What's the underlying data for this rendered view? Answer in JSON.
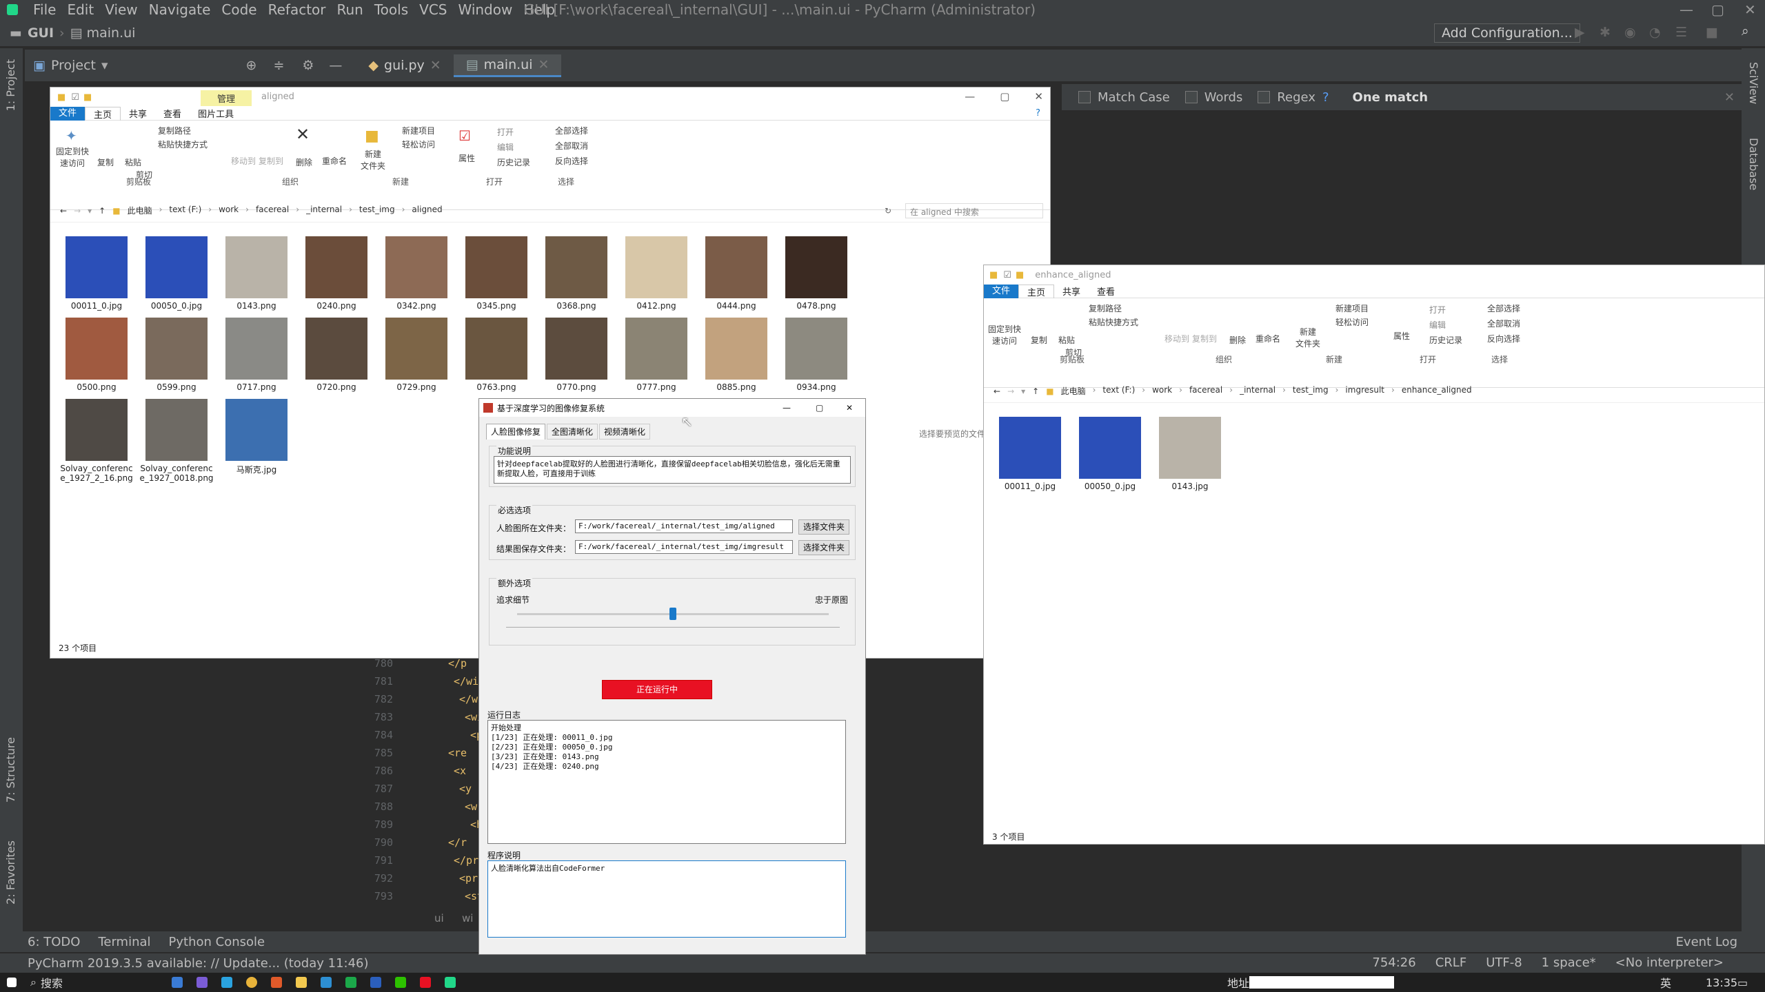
{
  "app": {
    "menu": [
      "File",
      "Edit",
      "View",
      "Navigate",
      "Code",
      "Refactor",
      "Run",
      "Tools",
      "VCS",
      "Window",
      "Help"
    ],
    "window_title": "GUI [F:\\work\\facereal\\_internal\\GUI] - ...\\main.ui - PyCharm (Administrator)",
    "breadcrumb_project": "GUI",
    "breadcrumb_file": "main.ui",
    "add_config": "Add Configuration...",
    "project_label": "Project",
    "tabs": [
      "gui.py",
      "main.ui"
    ],
    "find": {
      "match_case": "Match Case",
      "words": "Words",
      "regex": "Regex",
      "help": "?",
      "result": "One match"
    },
    "left_strip": [
      "1: Project",
      "7: Structure",
      "2: Favorites"
    ],
    "right_strip": [
      "SciView",
      "Database"
    ],
    "editor_lines": [
      {
        "n": "780",
        "t": "</p"
      },
      {
        "n": "781",
        "t": "</wi"
      },
      {
        "n": "782",
        "t": "</wid"
      },
      {
        "n": "783",
        "t": "<widg"
      },
      {
        "n": "784",
        "t": "<pro"
      },
      {
        "n": "785",
        "t": "<re"
      },
      {
        "n": "786",
        "t": "<x"
      },
      {
        "n": "787",
        "t": "<y"
      },
      {
        "n": "788",
        "t": "<w"
      },
      {
        "n": "789",
        "t": "<h"
      },
      {
        "n": "790",
        "t": "</r"
      },
      {
        "n": "791",
        "t": "</pro"
      },
      {
        "n": "792",
        "t": "<pro"
      },
      {
        "n": "793",
        "t": "<st"
      }
    ],
    "editor_breadcrumb": [
      "ui",
      "wi"
    ],
    "bottom_tabs": [
      "6: TODO",
      "Terminal",
      "Python Console"
    ],
    "event_log": "Event Log",
    "status_left": "PyCharm 2019.3.5 available: // Update... (today 11:46)",
    "status_right": [
      "754:26",
      "CRLF",
      "UTF-8",
      "1 space*",
      "<No interpreter>"
    ]
  },
  "explorer1": {
    "title": "aligned",
    "manage_tab": "管理",
    "tabs": [
      "文件",
      "主页",
      "共享",
      "查看",
      "图片工具"
    ],
    "ribbon": {
      "pin": "固定到快\n速访问",
      "copy": "复制",
      "paste": "粘贴",
      "copy_path": "复制路径",
      "paste_shortcut": "粘贴快捷方式",
      "cut": "剪切",
      "move_to": "移动到",
      "copy_to": "复制到",
      "delete": "删除",
      "rename": "重命名",
      "new_folder": "新建\n文件夹",
      "new_item": "新建项目",
      "easy_access": "轻松访问",
      "properties": "属性",
      "open": "打开",
      "edit": "编辑",
      "history": "历史记录",
      "select_all": "全部选择",
      "select_none": "全部取消",
      "invert": "反向选择",
      "groups": [
        "剪贴板",
        "组织",
        "新建",
        "打开",
        "选择"
      ]
    },
    "path": [
      "此电脑",
      "text (F:)",
      "work",
      "facereal",
      "_internal",
      "test_img",
      "aligned"
    ],
    "search_placeholder": "在 aligned 中搜索",
    "files": [
      "00011_0.jpg",
      "00050_0.jpg",
      "0143.png",
      "0240.png",
      "0342.png",
      "0345.png",
      "0368.png",
      "0412.png",
      "0444.png",
      "0478.png",
      "0500.png",
      "0599.png",
      "0717.png",
      "0720.png",
      "0729.png",
      "0763.png",
      "0770.png",
      "0777.png",
      "0885.png",
      "0934.png",
      "Solvay_conference_1927_2_16.png",
      "Solvay_conference_1927_0018.png",
      "马斯克.jpg"
    ],
    "count": "23 个项目",
    "preview_hint": "选择要预览的文件"
  },
  "explorer2": {
    "title": "enhance_aligned",
    "tabs": [
      "文件",
      "主页",
      "共享",
      "查看"
    ],
    "path": [
      "此电脑",
      "text (F:)",
      "work",
      "facereal",
      "_internal",
      "test_img",
      "imgresult",
      "enhance_aligned"
    ],
    "files": [
      "00011_0.jpg",
      "00050_0.jpg",
      "0143.jpg"
    ],
    "count": "3 个项目"
  },
  "dialog": {
    "title": "基于深度学习的图像修复系统",
    "tabs": [
      "人脸图像修复",
      "全图清晰化",
      "视频清晰化"
    ],
    "func_label": "功能说明",
    "func_text": "针对deepfacelab提取好的人脸图进行清晰化，直接保留deepfacelab相关切脸信息，强化后无需重新提取人脸，可直接用于训练",
    "required_label": "必选选项",
    "input_label": "人脸图所在文件夹：",
    "input_value": "F:/work/facereal/_internal/test_img/aligned",
    "output_label": "结果图保存文件夹：",
    "output_value": "F:/work/facereal/_internal/test_img/imgresult",
    "browse": "选择文件夹",
    "extra_label": "额外选项",
    "slider_left": "追求细节",
    "slider_right": "忠于原图",
    "slider_value": 0.5,
    "run_button": "正在运行中",
    "log_label": "运行日志",
    "log_text": "开始处理\n[1/23] 正在处理: 00011_0.jpg\n[2/23] 正在处理: 00050_0.jpg\n[3/23] 正在处理: 0143.png\n[4/23] 正在处理: 0240.png",
    "about_label": "程序说明",
    "about_text": "人脸清晰化算法出自CodeFormer"
  },
  "taskbar": {
    "search": "搜索",
    "address": "地址",
    "ime": "英",
    "time": "13:35"
  },
  "colors": {
    "run_button": "#e81123",
    "accent": "#1979ca",
    "ide_bg": "#2b2b2b",
    "ide_panel": "#3c3f41"
  }
}
